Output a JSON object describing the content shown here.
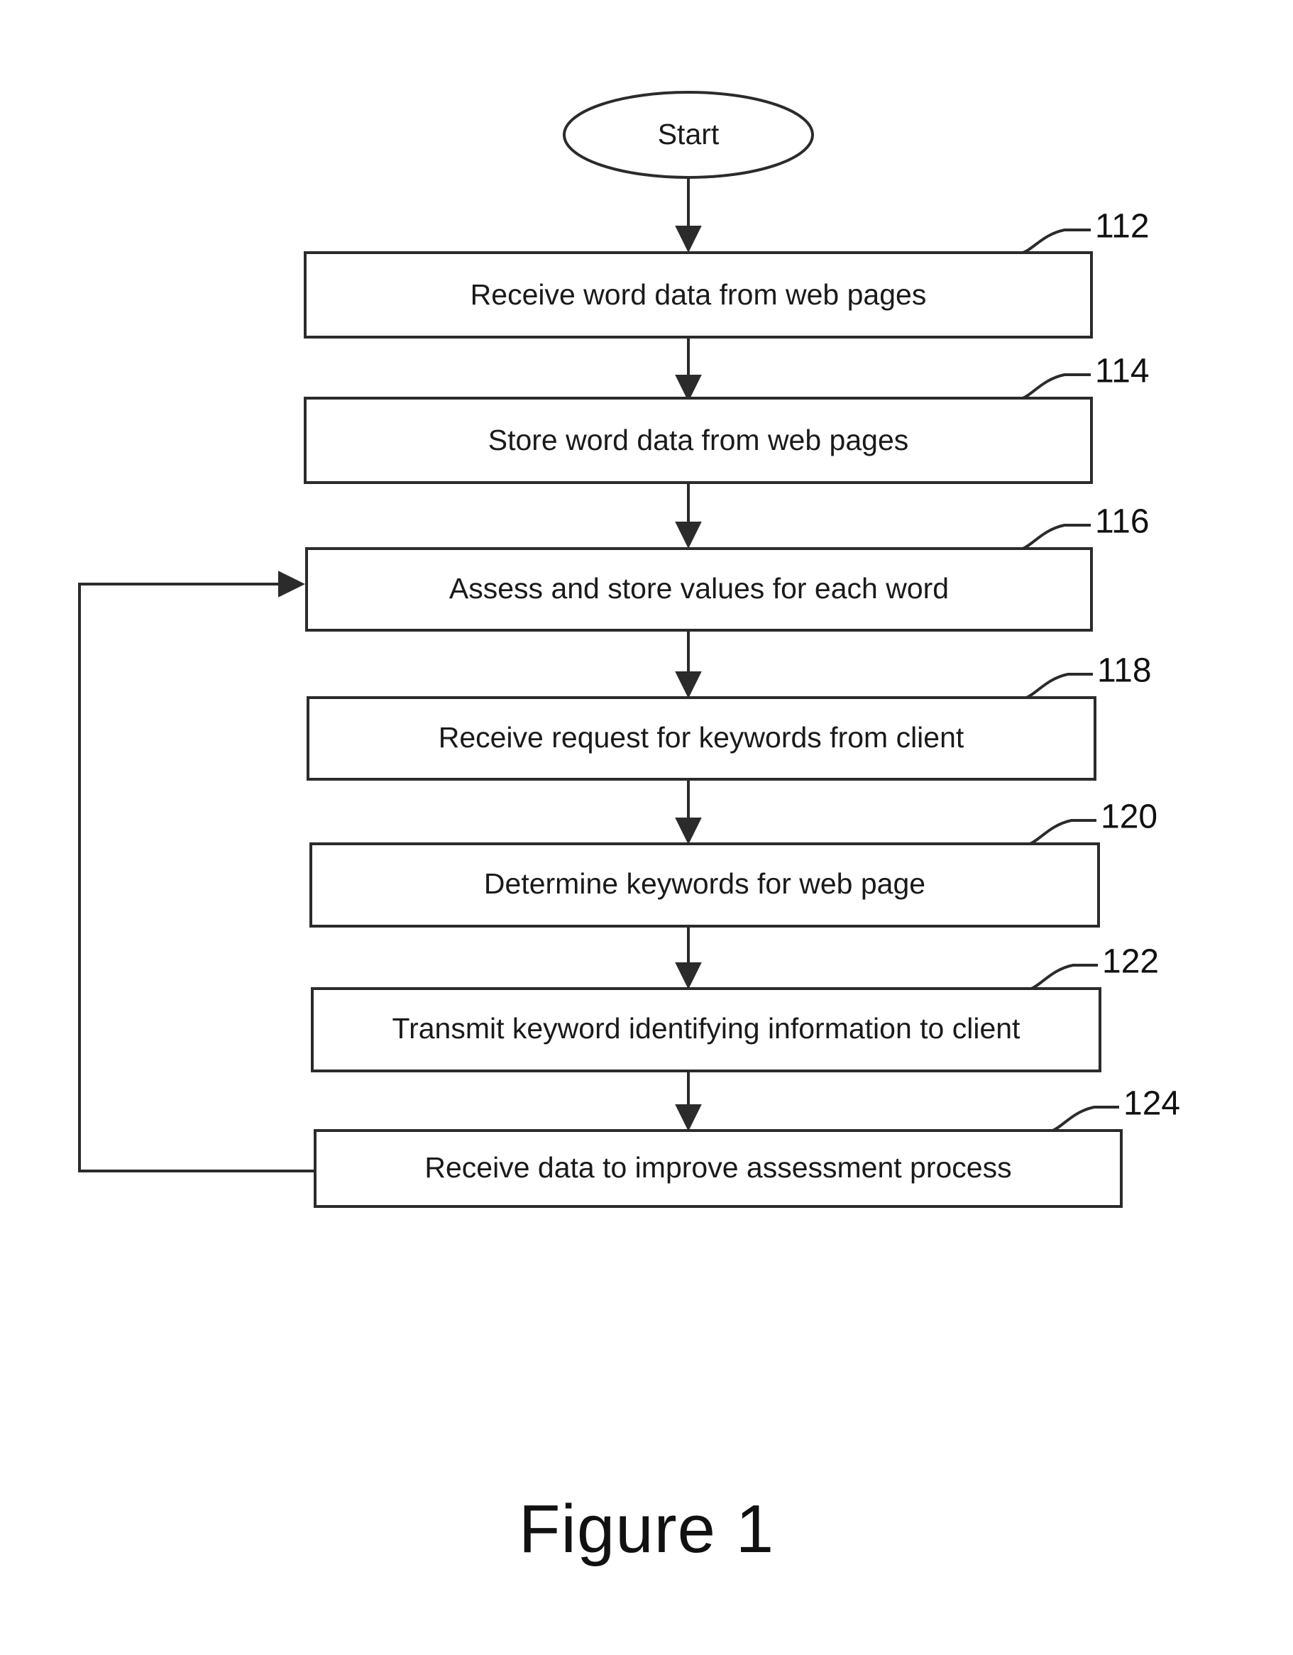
{
  "figure": {
    "caption": "Figure 1",
    "start_label": "Start"
  },
  "chart_data": {
    "type": "diagram",
    "title": "Figure 1",
    "subtype": "flowchart",
    "orientation": "top-to-bottom",
    "nodes": [
      {
        "id": "start",
        "shape": "ellipse",
        "label": "Start",
        "ref": ""
      },
      {
        "id": "n112",
        "shape": "rectangle",
        "label": "Receive word data from web pages",
        "ref": "112"
      },
      {
        "id": "n114",
        "shape": "rectangle",
        "label": "Store word data from web pages",
        "ref": "114"
      },
      {
        "id": "n116",
        "shape": "rectangle",
        "label": "Assess and store values for each word",
        "ref": "116"
      },
      {
        "id": "n118",
        "shape": "rectangle",
        "label": "Receive request for keywords from client",
        "ref": "118"
      },
      {
        "id": "n120",
        "shape": "rectangle",
        "label": "Determine keywords for web page",
        "ref": "120"
      },
      {
        "id": "n122",
        "shape": "rectangle",
        "label": "Transmit keyword identifying information to client",
        "ref": "122"
      },
      {
        "id": "n124",
        "shape": "rectangle",
        "label": "Receive data to improve assessment process",
        "ref": "124"
      }
    ],
    "edges": [
      {
        "from": "start",
        "to": "n112",
        "style": "arrow-down"
      },
      {
        "from": "n112",
        "to": "n114",
        "style": "arrow-down"
      },
      {
        "from": "n114",
        "to": "n116",
        "style": "arrow-down"
      },
      {
        "from": "n116",
        "to": "n118",
        "style": "arrow-down"
      },
      {
        "from": "n118",
        "to": "n120",
        "style": "arrow-down"
      },
      {
        "from": "n120",
        "to": "n122",
        "style": "arrow-down"
      },
      {
        "from": "n122",
        "to": "n124",
        "style": "arrow-down"
      },
      {
        "from": "n124",
        "to": "n116",
        "style": "feedback-left-loop"
      }
    ]
  },
  "nodes": {
    "start": {
      "label": "Start"
    },
    "n112": {
      "label": "Receive word data from web pages",
      "ref": "112"
    },
    "n114": {
      "label": "Store word data from web pages",
      "ref": "114"
    },
    "n116": {
      "label": "Assess and store values for each word",
      "ref": "116"
    },
    "n118": {
      "label": "Receive request for keywords from client",
      "ref": "118"
    },
    "n120": {
      "label": "Determine keywords for web page",
      "ref": "120"
    },
    "n122": {
      "label": "Transmit keyword identifying information to client",
      "ref": "122"
    },
    "n124": {
      "label": "Receive data to improve assessment process",
      "ref": "124"
    }
  },
  "colors": {
    "stroke": "#2b2b2b",
    "text": "#1a1a1a",
    "background": "#ffffff"
  }
}
